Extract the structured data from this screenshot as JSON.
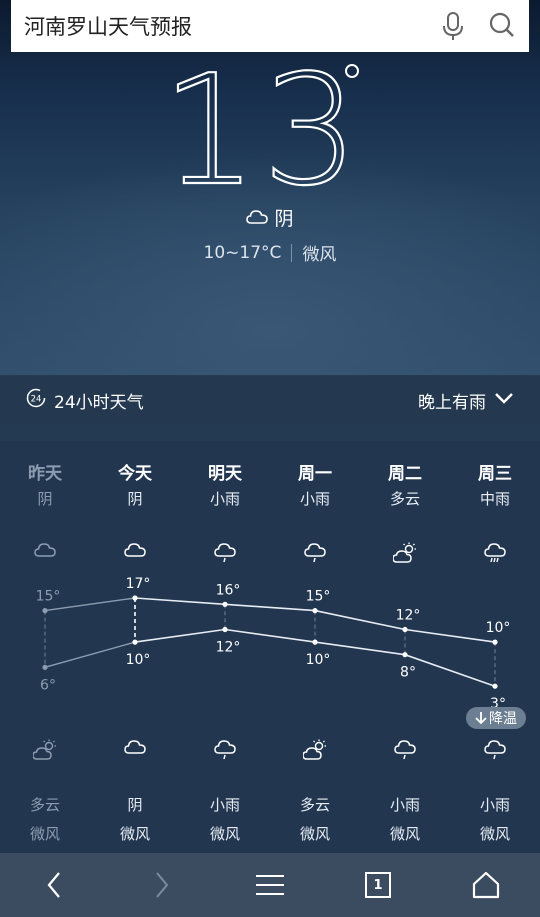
{
  "search": {
    "query": "河南罗山天气预报"
  },
  "current": {
    "temp": "13",
    "condition": "阴",
    "range": "10~17°C",
    "wind": "微风"
  },
  "hourly": {
    "label": "24小时天气",
    "icon_text": "24",
    "alert": "晚上有雨"
  },
  "days": [
    {
      "name": "昨天",
      "day_cond": "阴",
      "day_icon": "cloud-icon",
      "high": "15°",
      "low": "6°",
      "night_icon": "partly-cloudy-icon",
      "night_cond": "多云",
      "wind": "微风",
      "past": true
    },
    {
      "name": "今天",
      "day_cond": "阴",
      "day_icon": "cloud-icon",
      "high": "17°",
      "low": "10°",
      "night_icon": "cloud-icon",
      "night_cond": "阴",
      "wind": "微风",
      "past": false
    },
    {
      "name": "明天",
      "day_cond": "小雨",
      "day_icon": "light-rain-icon",
      "high": "16°",
      "low": "12°",
      "night_icon": "light-rain-icon",
      "night_cond": "小雨",
      "wind": "微风",
      "past": false
    },
    {
      "name": "周一",
      "day_cond": "小雨",
      "day_icon": "light-rain-icon",
      "high": "15°",
      "low": "10°",
      "night_icon": "partly-cloudy-icon",
      "night_cond": "多云",
      "wind": "微风",
      "past": false
    },
    {
      "name": "周二",
      "day_cond": "多云",
      "day_icon": "partly-cloudy-icon",
      "high": "12°",
      "low": "8°",
      "night_icon": "light-rain-icon",
      "night_cond": "小雨",
      "wind": "微风",
      "past": false
    },
    {
      "name": "周三",
      "day_cond": "中雨",
      "day_icon": "moderate-rain-icon",
      "high": "10°",
      "low": "3°",
      "night_icon": "light-rain-icon",
      "night_cond": "小雨",
      "wind": "微风",
      "past": false
    }
  ],
  "drop_badge": "降温",
  "nav": {
    "tab_count": "1"
  },
  "colors": {
    "panel": "#223650",
    "line": "#e6ecf2",
    "dim": "#8d9db0"
  }
}
